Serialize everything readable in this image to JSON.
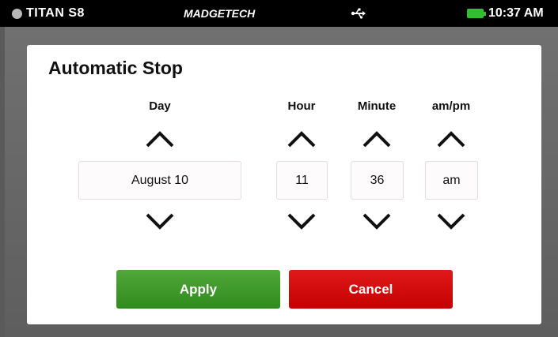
{
  "status_bar": {
    "device_name": "TITAN S8",
    "brand": "MADGETECH",
    "usb_icon": "usb-icon",
    "battery_icon": "battery-icon",
    "battery_color": "#2fbf2f",
    "time": "10:37 AM"
  },
  "dialog": {
    "title": "Automatic Stop",
    "columns": {
      "day": {
        "label": "Day",
        "value": "August 10"
      },
      "hour": {
        "label": "Hour",
        "value": "11"
      },
      "minute": {
        "label": "Minute",
        "value": "36"
      },
      "ampm": {
        "label": "am/pm",
        "value": "am"
      }
    },
    "increment_icon": "chevron-up-icon",
    "decrement_icon": "chevron-down-icon",
    "apply_label": "Apply",
    "cancel_label": "Cancel",
    "apply_color": "#3a9a25",
    "cancel_color": "#d40a0a"
  }
}
